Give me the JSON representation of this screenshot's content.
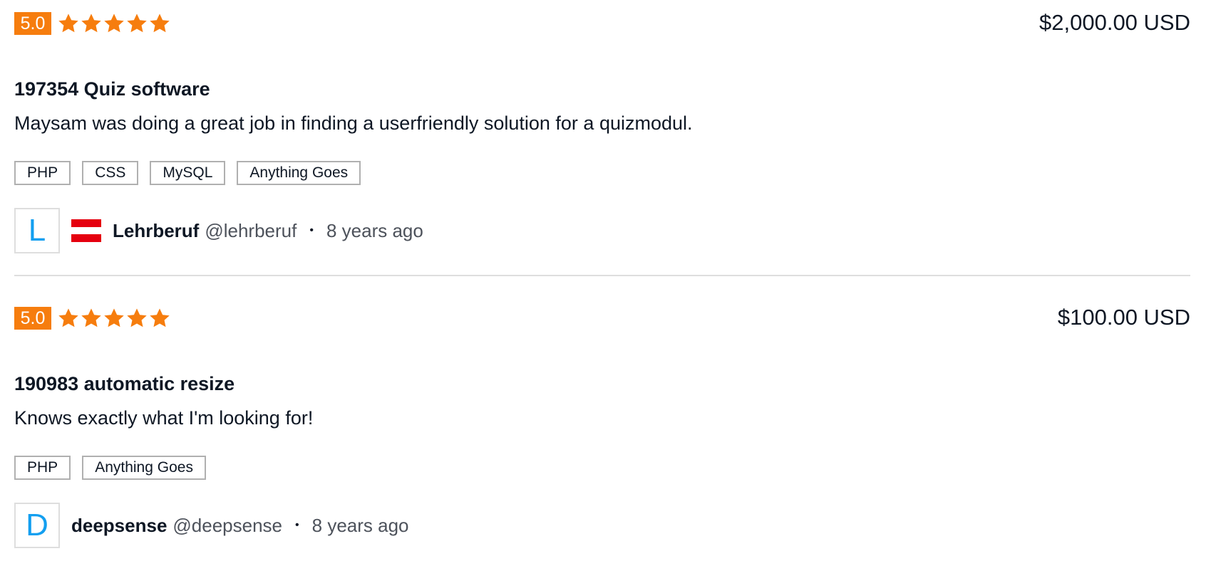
{
  "reviews": [
    {
      "score": "5.0",
      "stars": 5,
      "star_color": "#f67d0e",
      "price": "$2,000.00 USD",
      "title": "197354 Quiz software",
      "comment": "Maysam was doing a great job in finding a userfriendly solution for a quizmodul.",
      "tags": [
        "PHP",
        "CSS",
        "MySQL",
        "Anything Goes"
      ],
      "avatar_letter": "L",
      "flag_icon": "austria-flag-icon",
      "username": "Lehrberuf",
      "handle": "@lehrberuf",
      "separator": "•",
      "time": "8 years ago"
    },
    {
      "score": "5.0",
      "stars": 5,
      "star_color": "#f67d0e",
      "price": "$100.00 USD",
      "title": "190983 automatic resize",
      "comment": "Knows exactly what I'm looking for!",
      "tags": [
        "PHP",
        "Anything Goes"
      ],
      "avatar_letter": "D",
      "username": "deepsense",
      "handle": "@deepsense",
      "separator": "•",
      "time": "8 years ago"
    }
  ]
}
